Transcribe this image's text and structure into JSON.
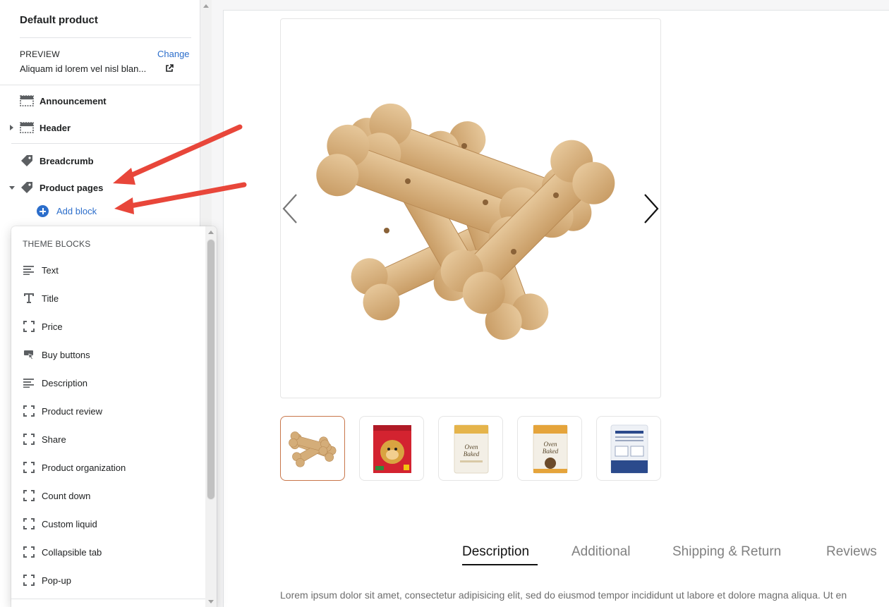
{
  "sidebar": {
    "title": "Default product",
    "preview_label": "PREVIEW",
    "preview_change": "Change",
    "preview_value": "Aliquam id lorem vel nisl blan...",
    "sections": {
      "announcement": "Announcement",
      "header": "Header",
      "breadcrumb": "Breadcrumb",
      "product_pages": "Product pages"
    },
    "add_block": "Add block"
  },
  "popover": {
    "heading": "THEME BLOCKS",
    "items": [
      {
        "label": "Text",
        "icon": "text-align-icon"
      },
      {
        "label": "Title",
        "icon": "title-t-icon"
      },
      {
        "label": "Price",
        "icon": "dashed-square-icon"
      },
      {
        "label": "Buy buttons",
        "icon": "buy-button-icon"
      },
      {
        "label": "Description",
        "icon": "text-align-icon"
      },
      {
        "label": "Product review",
        "icon": "dashed-square-icon"
      },
      {
        "label": "Share",
        "icon": "dashed-square-icon"
      },
      {
        "label": "Product organization",
        "icon": "dashed-square-icon"
      },
      {
        "label": "Count down",
        "icon": "dashed-square-icon"
      },
      {
        "label": "Custom liquid",
        "icon": "dashed-square-icon"
      },
      {
        "label": "Collapsible tab",
        "icon": "dashed-square-icon"
      },
      {
        "label": "Pop-up",
        "icon": "dashed-square-icon"
      }
    ]
  },
  "product": {
    "tabs": [
      "Description",
      "Additional",
      "Shipping & Return",
      "Reviews"
    ],
    "description": "Lorem ipsum dolor sit amet, consectetur adipisicing elit, sed do eiusmod tempor incididunt ut labore et dolore magna aliqua. Ut en"
  },
  "colors": {
    "accent": "#2c6ecb",
    "annotation_arrow": "#e8463a",
    "active_thumb_border": "#c8764a"
  }
}
